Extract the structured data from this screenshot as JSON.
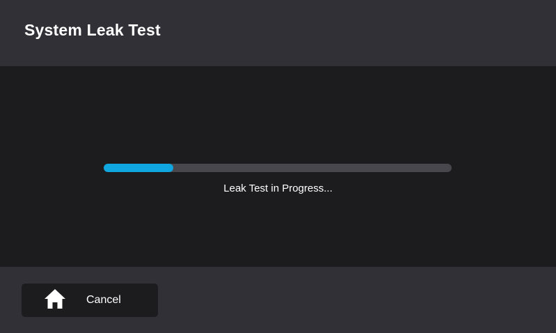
{
  "header": {
    "title": "System Leak Test"
  },
  "main": {
    "progress_fraction": 0.2,
    "status_text": "Leak Test in Progress..."
  },
  "footer": {
    "cancel_label": "Cancel",
    "cancel_icon": "home-icon"
  },
  "colors": {
    "header_bg": "#313036",
    "main_bg": "#1c1c1e",
    "progress_track": "#48474d",
    "progress_fill": "#10a6e0",
    "text": "#ffffff"
  }
}
